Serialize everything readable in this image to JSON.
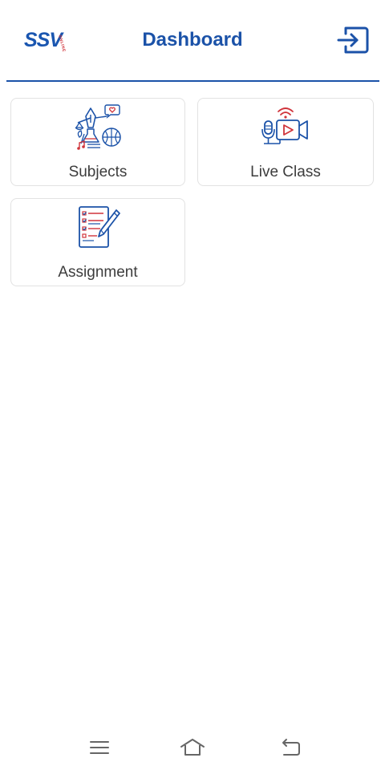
{
  "header": {
    "logo_text": "SSV",
    "logo_sub": "ONLINE",
    "title": "Dashboard",
    "logout_icon": "logout-icon"
  },
  "tiles": [
    {
      "label": "Subjects",
      "icon": "subjects-icon"
    },
    {
      "label": "Live Class",
      "icon": "live-class-icon"
    },
    {
      "label": "Assignment",
      "icon": "assignment-icon"
    }
  ],
  "nav": {
    "menu_icon": "menu-icon",
    "home_icon": "home-icon",
    "back_icon": "back-icon"
  },
  "colors": {
    "primary": "#1b52a8",
    "accent": "#d0343b",
    "tile_border": "#e2e2e2",
    "label_text": "#3c3c3c",
    "nav_icon": "#666666"
  }
}
